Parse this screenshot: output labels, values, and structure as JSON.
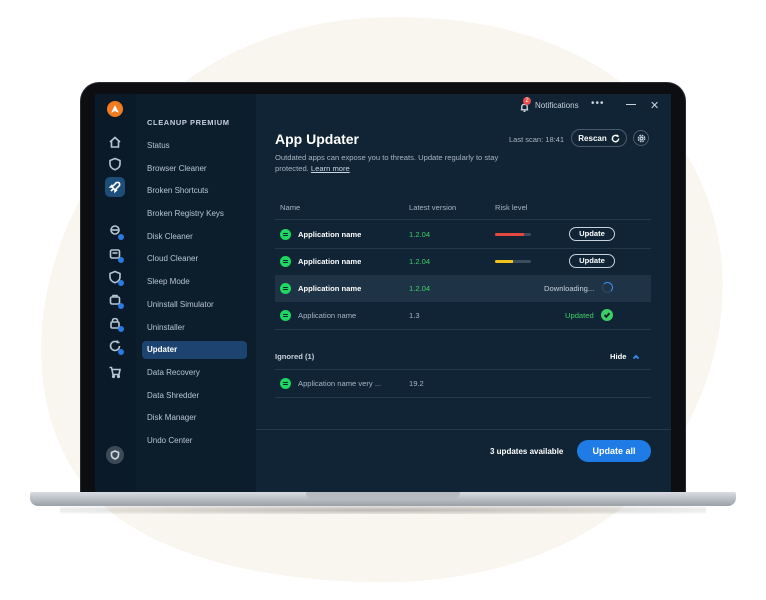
{
  "colors": {
    "accent": "#1f7be5",
    "success": "#3ccf66",
    "risk_high": "#e2483d",
    "risk_medium": "#f2c21b",
    "brand": "#f47a20"
  },
  "notifications": {
    "label": "Notifications",
    "badge": "2"
  },
  "menu": {
    "title": "CLEANUP PREMIUM",
    "items": [
      "Status",
      "Browser Cleaner",
      "Broken Shortcuts",
      "Broken Registry Keys",
      "Disk Cleaner",
      "Cloud Cleaner",
      "Sleep Mode",
      "Uninstall Simulator",
      "Uninstaller",
      "Updater",
      "Data Recovery",
      "Data Shredder",
      "Disk Manager",
      "Undo Center"
    ],
    "active": "Updater"
  },
  "rail_icons": [
    "home-icon",
    "shield-icon",
    "rocket-icon",
    "browser-clean-icon",
    "disk-clean-icon",
    "cloud-icon",
    "sleep-icon",
    "uninstall-icon",
    "lock-icon",
    "refresh-icon",
    "cart-icon"
  ],
  "header": {
    "title": "App Updater",
    "subtitle": "Outdated apps can expose you to threats. Update regularly to stay protected.",
    "learn_more": "Learn more",
    "last_scan": "Last scan: 18:41",
    "rescan": "Rescan"
  },
  "table": {
    "columns": [
      "Name",
      "Latest version",
      "Risk level"
    ],
    "rows": [
      {
        "name": "Application name",
        "version": "1.2.04",
        "risk": 0.8,
        "risk_color": "#e2483d",
        "action": "Update"
      },
      {
        "name": "Application name",
        "version": "1.2.04",
        "risk": 0.5,
        "risk_color": "#f2c21b",
        "action": "Update"
      },
      {
        "name": "Application name",
        "version": "1.2.04",
        "status": "Downloading..."
      },
      {
        "name": "Application name",
        "version": "1.3",
        "status": "Updated"
      }
    ]
  },
  "ignored": {
    "label": "Ignored (1)",
    "toggle": "Hide",
    "rows": [
      {
        "name": "Application name very ...",
        "version": "19.2"
      }
    ]
  },
  "footer": {
    "summary": "3 updates available",
    "update_all": "Update all"
  }
}
